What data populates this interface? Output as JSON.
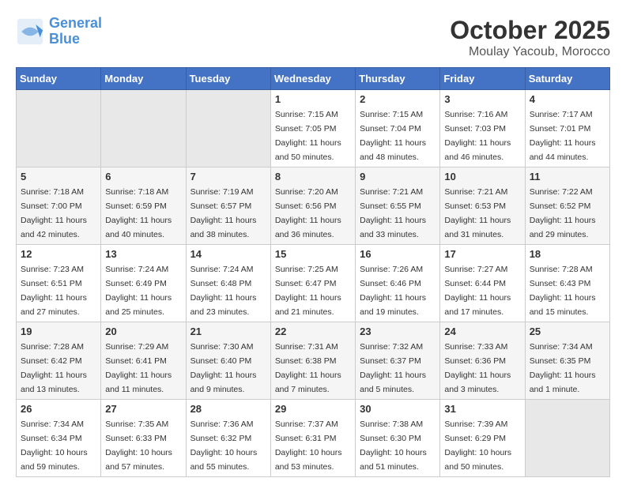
{
  "header": {
    "logo_line1": "General",
    "logo_line2": "Blue",
    "month_year": "October 2025",
    "location": "Moulay Yacoub, Morocco"
  },
  "weekdays": [
    "Sunday",
    "Monday",
    "Tuesday",
    "Wednesday",
    "Thursday",
    "Friday",
    "Saturday"
  ],
  "weeks": [
    [
      {
        "day": "",
        "empty": true
      },
      {
        "day": "",
        "empty": true
      },
      {
        "day": "",
        "empty": true
      },
      {
        "day": "1",
        "sunrise": "7:15 AM",
        "sunset": "7:05 PM",
        "daylight": "11 hours and 50 minutes."
      },
      {
        "day": "2",
        "sunrise": "7:15 AM",
        "sunset": "7:04 PM",
        "daylight": "11 hours and 48 minutes."
      },
      {
        "day": "3",
        "sunrise": "7:16 AM",
        "sunset": "7:03 PM",
        "daylight": "11 hours and 46 minutes."
      },
      {
        "day": "4",
        "sunrise": "7:17 AM",
        "sunset": "7:01 PM",
        "daylight": "11 hours and 44 minutes."
      }
    ],
    [
      {
        "day": "5",
        "sunrise": "7:18 AM",
        "sunset": "7:00 PM",
        "daylight": "11 hours and 42 minutes."
      },
      {
        "day": "6",
        "sunrise": "7:18 AM",
        "sunset": "6:59 PM",
        "daylight": "11 hours and 40 minutes."
      },
      {
        "day": "7",
        "sunrise": "7:19 AM",
        "sunset": "6:57 PM",
        "daylight": "11 hours and 38 minutes."
      },
      {
        "day": "8",
        "sunrise": "7:20 AM",
        "sunset": "6:56 PM",
        "daylight": "11 hours and 36 minutes."
      },
      {
        "day": "9",
        "sunrise": "7:21 AM",
        "sunset": "6:55 PM",
        "daylight": "11 hours and 33 minutes."
      },
      {
        "day": "10",
        "sunrise": "7:21 AM",
        "sunset": "6:53 PM",
        "daylight": "11 hours and 31 minutes."
      },
      {
        "day": "11",
        "sunrise": "7:22 AM",
        "sunset": "6:52 PM",
        "daylight": "11 hours and 29 minutes."
      }
    ],
    [
      {
        "day": "12",
        "sunrise": "7:23 AM",
        "sunset": "6:51 PM",
        "daylight": "11 hours and 27 minutes."
      },
      {
        "day": "13",
        "sunrise": "7:24 AM",
        "sunset": "6:49 PM",
        "daylight": "11 hours and 25 minutes."
      },
      {
        "day": "14",
        "sunrise": "7:24 AM",
        "sunset": "6:48 PM",
        "daylight": "11 hours and 23 minutes."
      },
      {
        "day": "15",
        "sunrise": "7:25 AM",
        "sunset": "6:47 PM",
        "daylight": "11 hours and 21 minutes."
      },
      {
        "day": "16",
        "sunrise": "7:26 AM",
        "sunset": "6:46 PM",
        "daylight": "11 hours and 19 minutes."
      },
      {
        "day": "17",
        "sunrise": "7:27 AM",
        "sunset": "6:44 PM",
        "daylight": "11 hours and 17 minutes."
      },
      {
        "day": "18",
        "sunrise": "7:28 AM",
        "sunset": "6:43 PM",
        "daylight": "11 hours and 15 minutes."
      }
    ],
    [
      {
        "day": "19",
        "sunrise": "7:28 AM",
        "sunset": "6:42 PM",
        "daylight": "11 hours and 13 minutes."
      },
      {
        "day": "20",
        "sunrise": "7:29 AM",
        "sunset": "6:41 PM",
        "daylight": "11 hours and 11 minutes."
      },
      {
        "day": "21",
        "sunrise": "7:30 AM",
        "sunset": "6:40 PM",
        "daylight": "11 hours and 9 minutes."
      },
      {
        "day": "22",
        "sunrise": "7:31 AM",
        "sunset": "6:38 PM",
        "daylight": "11 hours and 7 minutes."
      },
      {
        "day": "23",
        "sunrise": "7:32 AM",
        "sunset": "6:37 PM",
        "daylight": "11 hours and 5 minutes."
      },
      {
        "day": "24",
        "sunrise": "7:33 AM",
        "sunset": "6:36 PM",
        "daylight": "11 hours and 3 minutes."
      },
      {
        "day": "25",
        "sunrise": "7:34 AM",
        "sunset": "6:35 PM",
        "daylight": "11 hours and 1 minute."
      }
    ],
    [
      {
        "day": "26",
        "sunrise": "7:34 AM",
        "sunset": "6:34 PM",
        "daylight": "10 hours and 59 minutes."
      },
      {
        "day": "27",
        "sunrise": "7:35 AM",
        "sunset": "6:33 PM",
        "daylight": "10 hours and 57 minutes."
      },
      {
        "day": "28",
        "sunrise": "7:36 AM",
        "sunset": "6:32 PM",
        "daylight": "10 hours and 55 minutes."
      },
      {
        "day": "29",
        "sunrise": "7:37 AM",
        "sunset": "6:31 PM",
        "daylight": "10 hours and 53 minutes."
      },
      {
        "day": "30",
        "sunrise": "7:38 AM",
        "sunset": "6:30 PM",
        "daylight": "10 hours and 51 minutes."
      },
      {
        "day": "31",
        "sunrise": "7:39 AM",
        "sunset": "6:29 PM",
        "daylight": "10 hours and 50 minutes."
      },
      {
        "day": "",
        "empty": true
      }
    ]
  ]
}
